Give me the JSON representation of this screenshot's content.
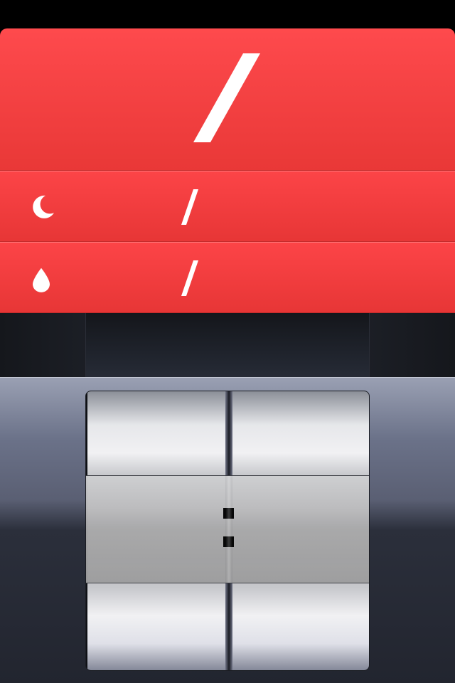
{
  "main_value": {
    "text": "/"
  },
  "rows": [
    {
      "icon": "moon-icon",
      "text": "/"
    },
    {
      "icon": "water-drop-icon",
      "text": "/"
    }
  ],
  "time_picker": {
    "separator": ":"
  },
  "colors": {
    "accent_red": "#fe4a4d",
    "text_white": "#ffffff",
    "dark_band": "#14161b"
  }
}
